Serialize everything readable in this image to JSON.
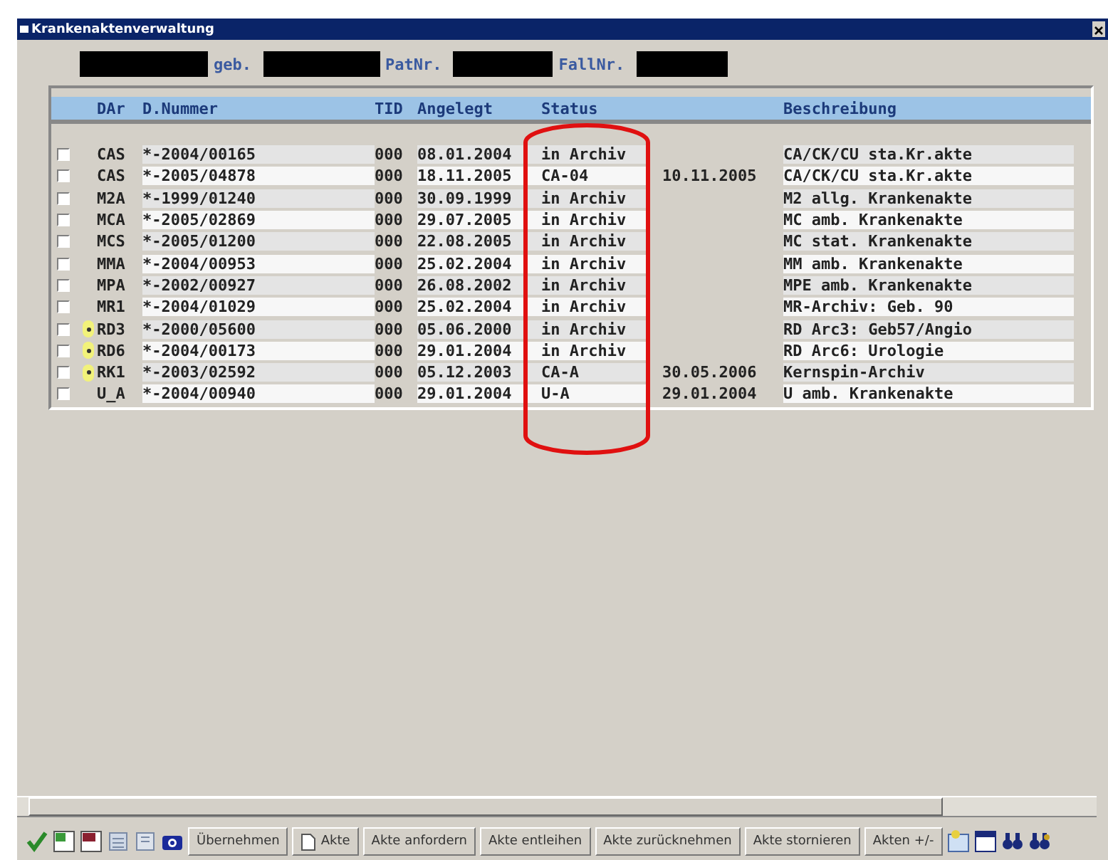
{
  "window": {
    "title": "Krankenaktenverwaltung"
  },
  "patient_header": {
    "labels": [
      "geb.",
      "PatNr.",
      "FallNr."
    ]
  },
  "table": {
    "columns": [
      "DAr",
      "D.Nummer",
      "TID",
      "Angelegt",
      "Status",
      "Beschreibung"
    ],
    "rows": [
      {
        "checked": false,
        "flagged": false,
        "dar": "CAS",
        "nummer": "*-2004/00165",
        "tid": "000",
        "angelegt": "08.01.2004",
        "status": "in Archiv",
        "date": "",
        "beschreibung": "CA/CK/CU sta.Kr.akte"
      },
      {
        "checked": false,
        "flagged": false,
        "dar": "CAS",
        "nummer": "*-2005/04878",
        "tid": "000",
        "angelegt": "18.11.2005",
        "status": "CA-04",
        "date": "10.11.2005",
        "beschreibung": "CA/CK/CU sta.Kr.akte"
      },
      {
        "checked": false,
        "flagged": false,
        "dar": "M2A",
        "nummer": "*-1999/01240",
        "tid": "000",
        "angelegt": "30.09.1999",
        "status": "in Archiv",
        "date": "",
        "beschreibung": "M2 allg. Krankenakte"
      },
      {
        "checked": false,
        "flagged": false,
        "dar": "MCA",
        "nummer": "*-2005/02869",
        "tid": "000",
        "angelegt": "29.07.2005",
        "status": "in Archiv",
        "date": "",
        "beschreibung": "MC amb. Krankenakte"
      },
      {
        "checked": false,
        "flagged": false,
        "dar": "MCS",
        "nummer": "*-2005/01200",
        "tid": "000",
        "angelegt": "22.08.2005",
        "status": "in Archiv",
        "date": "",
        "beschreibung": "MC stat. Krankenakte"
      },
      {
        "checked": false,
        "flagged": false,
        "dar": "MMA",
        "nummer": "*-2004/00953",
        "tid": "000",
        "angelegt": "25.02.2004",
        "status": "in Archiv",
        "date": "",
        "beschreibung": "MM amb. Krankenakte"
      },
      {
        "checked": false,
        "flagged": false,
        "dar": "MPA",
        "nummer": "*-2002/00927",
        "tid": "000",
        "angelegt": "26.08.2002",
        "status": "in Archiv",
        "date": "",
        "beschreibung": "MPE amb. Krankenakte"
      },
      {
        "checked": false,
        "flagged": false,
        "dar": "MR1",
        "nummer": "*-2004/01029",
        "tid": "000",
        "angelegt": "25.02.2004",
        "status": "in Archiv",
        "date": "",
        "beschreibung": "MR-Archiv: Geb. 90"
      },
      {
        "checked": false,
        "flagged": true,
        "dar": "RD3",
        "nummer": "*-2000/05600",
        "tid": "000",
        "angelegt": "05.06.2000",
        "status": "in Archiv",
        "date": "",
        "beschreibung": "RD Arc3: Geb57/Angio"
      },
      {
        "checked": false,
        "flagged": true,
        "dar": "RD6",
        "nummer": "*-2004/00173",
        "tid": "000",
        "angelegt": "29.01.2004",
        "status": "in Archiv",
        "date": "",
        "beschreibung": "RD Arc6: Urologie"
      },
      {
        "checked": false,
        "flagged": true,
        "dar": "RK1",
        "nummer": "*-2003/02592",
        "tid": "000",
        "angelegt": "05.12.2003",
        "status": "CA-A",
        "date": "30.05.2006",
        "beschreibung": "Kernspin-Archiv"
      },
      {
        "checked": false,
        "flagged": false,
        "dar": "U_A",
        "nummer": "*-2004/00940",
        "tid": "000",
        "angelegt": "29.01.2004",
        "status": "U-A",
        "date": "29.01.2004",
        "beschreibung": "U amb. Krankenakte"
      }
    ]
  },
  "toolbar": {
    "buttons": [
      {
        "label": "Übernehmen",
        "kind": "text"
      },
      {
        "label": "Akte",
        "kind": "document"
      },
      {
        "label": "Akte anfordern",
        "kind": "text"
      },
      {
        "label": "Akte entleihen",
        "kind": "text"
      },
      {
        "label": "Akte zurücknehmen",
        "kind": "text"
      },
      {
        "label": "Akte stornieren",
        "kind": "text"
      },
      {
        "label": "Akten +/-",
        "kind": "text"
      }
    ]
  }
}
